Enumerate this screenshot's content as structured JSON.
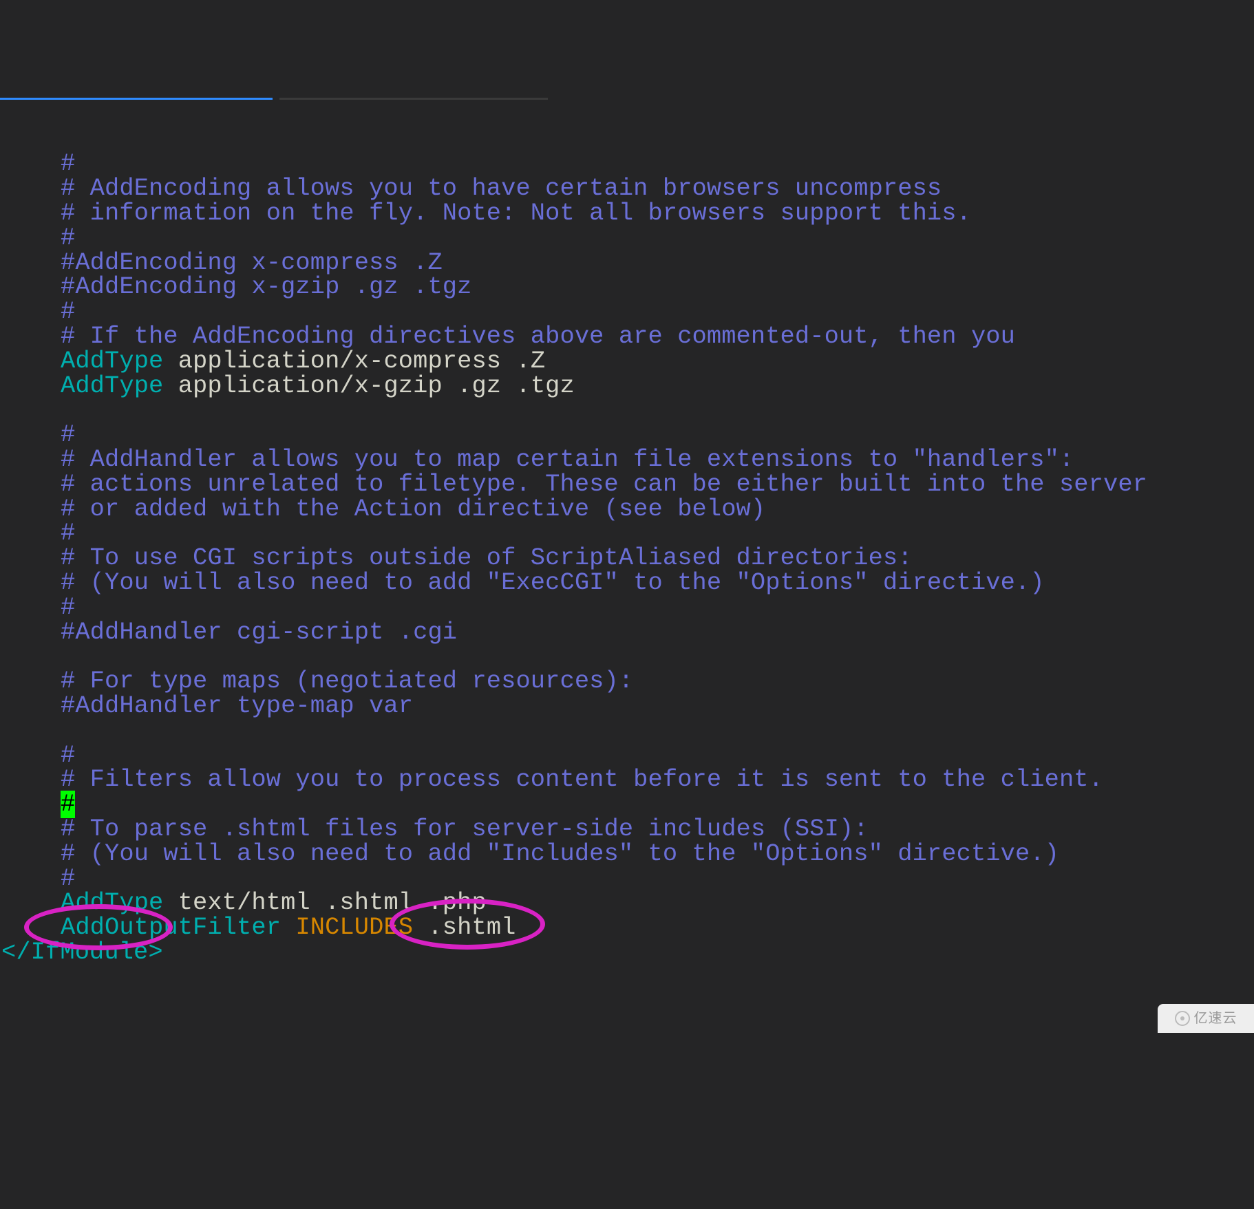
{
  "lines": [
    {
      "segments": [
        {
          "cls": "comment",
          "text": "#"
        }
      ]
    },
    {
      "segments": [
        {
          "cls": "comment",
          "text": "# AddEncoding allows you to have certain browsers uncompress"
        }
      ]
    },
    {
      "segments": [
        {
          "cls": "comment",
          "text": "# information on the fly. Note: Not all browsers support this."
        }
      ]
    },
    {
      "segments": [
        {
          "cls": "comment",
          "text": "#"
        }
      ]
    },
    {
      "segments": [
        {
          "cls": "comment",
          "text": "#AddEncoding x-compress .Z"
        }
      ]
    },
    {
      "segments": [
        {
          "cls": "comment",
          "text": "#AddEncoding x-gzip .gz .tgz"
        }
      ]
    },
    {
      "segments": [
        {
          "cls": "comment",
          "text": "#"
        }
      ]
    },
    {
      "segments": [
        {
          "cls": "comment",
          "text": "# If the AddEncoding directives above are commented-out, then you"
        }
      ]
    },
    {
      "segments": [
        {
          "cls": "keyword",
          "text": "AddType"
        },
        {
          "cls": "plain",
          "text": " application/x-compress .Z"
        }
      ]
    },
    {
      "segments": [
        {
          "cls": "keyword",
          "text": "AddType"
        },
        {
          "cls": "plain",
          "text": " application/x-gzip .gz .tgz"
        }
      ]
    },
    {
      "segments": [
        {
          "cls": "plain",
          "text": ""
        }
      ]
    },
    {
      "segments": [
        {
          "cls": "comment",
          "text": "#"
        }
      ]
    },
    {
      "segments": [
        {
          "cls": "comment",
          "text": "# AddHandler allows you to map certain file extensions to \"handlers\":"
        }
      ]
    },
    {
      "segments": [
        {
          "cls": "comment",
          "text": "# actions unrelated to filetype. These can be either built into the server"
        }
      ]
    },
    {
      "segments": [
        {
          "cls": "comment",
          "text": "# or added with the Action directive (see below)"
        }
      ]
    },
    {
      "segments": [
        {
          "cls": "comment",
          "text": "#"
        }
      ]
    },
    {
      "segments": [
        {
          "cls": "comment",
          "text": "# To use CGI scripts outside of ScriptAliased directories:"
        }
      ]
    },
    {
      "segments": [
        {
          "cls": "comment",
          "text": "# (You will also need to add \"ExecCGI\" to the \"Options\" directive.)"
        }
      ]
    },
    {
      "segments": [
        {
          "cls": "comment",
          "text": "#"
        }
      ]
    },
    {
      "segments": [
        {
          "cls": "comment",
          "text": "#AddHandler cgi-script .cgi"
        }
      ]
    },
    {
      "segments": [
        {
          "cls": "plain",
          "text": ""
        }
      ]
    },
    {
      "segments": [
        {
          "cls": "comment",
          "text": "# For type maps (negotiated resources):"
        }
      ]
    },
    {
      "segments": [
        {
          "cls": "comment",
          "text": "#AddHandler type-map var"
        }
      ]
    },
    {
      "segments": [
        {
          "cls": "plain",
          "text": ""
        }
      ]
    },
    {
      "segments": [
        {
          "cls": "comment",
          "text": "#"
        }
      ]
    },
    {
      "segments": [
        {
          "cls": "comment",
          "text": "# Filters allow you to process content before it is sent to the client."
        }
      ]
    },
    {
      "segments": [
        {
          "cls": "cursor",
          "text": "#"
        }
      ]
    },
    {
      "segments": [
        {
          "cls": "comment",
          "text": "# To parse .shtml files for server-side includes (SSI):"
        }
      ]
    },
    {
      "segments": [
        {
          "cls": "comment",
          "text": "# (You will also need to add \"Includes\" to the \"Options\" directive.)"
        }
      ]
    },
    {
      "segments": [
        {
          "cls": "comment",
          "text": "#"
        }
      ]
    },
    {
      "segments": [
        {
          "cls": "keyword",
          "text": "AddType"
        },
        {
          "cls": "plain",
          "text": " text/html .shtml .php"
        }
      ]
    },
    {
      "segments": [
        {
          "cls": "keyword",
          "text": "AddOutputFilter"
        },
        {
          "cls": "plain",
          "text": " "
        },
        {
          "cls": "orange",
          "text": "INCLUDES"
        },
        {
          "cls": "plain",
          "text": " .shtml"
        }
      ]
    }
  ],
  "closing_tag": "</IfModule>",
  "watermark": "亿速云"
}
